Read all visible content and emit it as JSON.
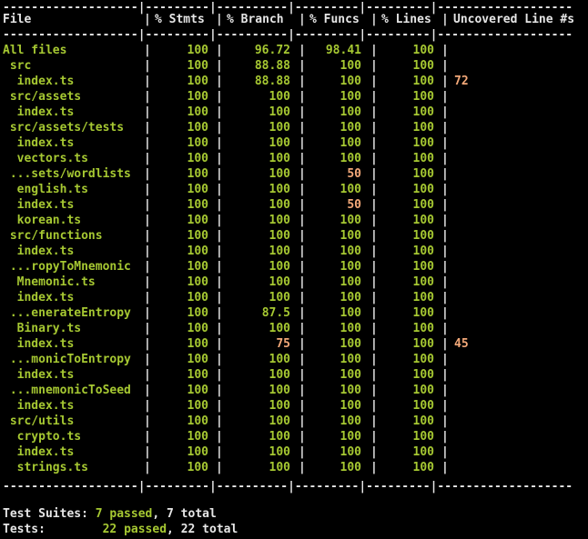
{
  "header": {
    "file": "File",
    "stmts": "% Stmts",
    "branch": "% Branch",
    "funcs": "% Funcs",
    "lines": "% Lines",
    "uncovered": "Uncovered Line #s"
  },
  "rows": [
    {
      "file": "All files",
      "stmts": "100",
      "branch": "96.72",
      "funcs": "98.41",
      "lines": "100",
      "uncovered": ""
    },
    {
      "file": " src",
      "stmts": "100",
      "branch": "88.88",
      "funcs": "100",
      "lines": "100",
      "uncovered": ""
    },
    {
      "file": "  index.ts",
      "stmts": "100",
      "branch": "88.88",
      "funcs": "100",
      "lines": "100",
      "uncovered": "72"
    },
    {
      "file": " src/assets",
      "stmts": "100",
      "branch": "100",
      "funcs": "100",
      "lines": "100",
      "uncovered": ""
    },
    {
      "file": "  index.ts",
      "stmts": "100",
      "branch": "100",
      "funcs": "100",
      "lines": "100",
      "uncovered": ""
    },
    {
      "file": " src/assets/tests",
      "stmts": "100",
      "branch": "100",
      "funcs": "100",
      "lines": "100",
      "uncovered": ""
    },
    {
      "file": "  index.ts",
      "stmts": "100",
      "branch": "100",
      "funcs": "100",
      "lines": "100",
      "uncovered": ""
    },
    {
      "file": "  vectors.ts",
      "stmts": "100",
      "branch": "100",
      "funcs": "100",
      "lines": "100",
      "uncovered": ""
    },
    {
      "file": " ...sets/wordlists",
      "stmts": "100",
      "branch": "100",
      "funcs": "50",
      "lines": "100",
      "uncovered": ""
    },
    {
      "file": "  english.ts",
      "stmts": "100",
      "branch": "100",
      "funcs": "100",
      "lines": "100",
      "uncovered": ""
    },
    {
      "file": "  index.ts",
      "stmts": "100",
      "branch": "100",
      "funcs": "50",
      "lines": "100",
      "uncovered": ""
    },
    {
      "file": "  korean.ts",
      "stmts": "100",
      "branch": "100",
      "funcs": "100",
      "lines": "100",
      "uncovered": ""
    },
    {
      "file": " src/functions",
      "stmts": "100",
      "branch": "100",
      "funcs": "100",
      "lines": "100",
      "uncovered": ""
    },
    {
      "file": "  index.ts",
      "stmts": "100",
      "branch": "100",
      "funcs": "100",
      "lines": "100",
      "uncovered": ""
    },
    {
      "file": " ...ropyToMnemonic",
      "stmts": "100",
      "branch": "100",
      "funcs": "100",
      "lines": "100",
      "uncovered": ""
    },
    {
      "file": "  Mnemonic.ts",
      "stmts": "100",
      "branch": "100",
      "funcs": "100",
      "lines": "100",
      "uncovered": ""
    },
    {
      "file": "  index.ts",
      "stmts": "100",
      "branch": "100",
      "funcs": "100",
      "lines": "100",
      "uncovered": ""
    },
    {
      "file": " ...enerateEntropy",
      "stmts": "100",
      "branch": "87.5",
      "funcs": "100",
      "lines": "100",
      "uncovered": ""
    },
    {
      "file": "  Binary.ts",
      "stmts": "100",
      "branch": "100",
      "funcs": "100",
      "lines": "100",
      "uncovered": ""
    },
    {
      "file": "  index.ts",
      "stmts": "100",
      "branch": "75",
      "funcs": "100",
      "lines": "100",
      "uncovered": "45"
    },
    {
      "file": " ...monicToEntropy",
      "stmts": "100",
      "branch": "100",
      "funcs": "100",
      "lines": "100",
      "uncovered": ""
    },
    {
      "file": "  index.ts",
      "stmts": "100",
      "branch": "100",
      "funcs": "100",
      "lines": "100",
      "uncovered": ""
    },
    {
      "file": " ...mnemonicToSeed",
      "stmts": "100",
      "branch": "100",
      "funcs": "100",
      "lines": "100",
      "uncovered": ""
    },
    {
      "file": "  index.ts",
      "stmts": "100",
      "branch": "100",
      "funcs": "100",
      "lines": "100",
      "uncovered": ""
    },
    {
      "file": " src/utils",
      "stmts": "100",
      "branch": "100",
      "funcs": "100",
      "lines": "100",
      "uncovered": ""
    },
    {
      "file": "  crypto.ts",
      "stmts": "100",
      "branch": "100",
      "funcs": "100",
      "lines": "100",
      "uncovered": ""
    },
    {
      "file": "  index.ts",
      "stmts": "100",
      "branch": "100",
      "funcs": "100",
      "lines": "100",
      "uncovered": ""
    },
    {
      "file": "  strings.ts",
      "stmts": "100",
      "branch": "100",
      "funcs": "100",
      "lines": "100",
      "uncovered": ""
    }
  ],
  "highlight_cells": {
    "funcs_50": true,
    "branch_75": true
  },
  "summary": {
    "suites_label": "Test Suites:",
    "suites_passed": "7 passed",
    "suites_total": ", 7 total",
    "tests_label": "Tests:",
    "tests_passed": "22 passed",
    "tests_total": ", 22 total"
  },
  "colors": {
    "background": "#000000",
    "text": "#e6e6e6",
    "covered": "#a6c832",
    "partial": "#f4a979"
  }
}
